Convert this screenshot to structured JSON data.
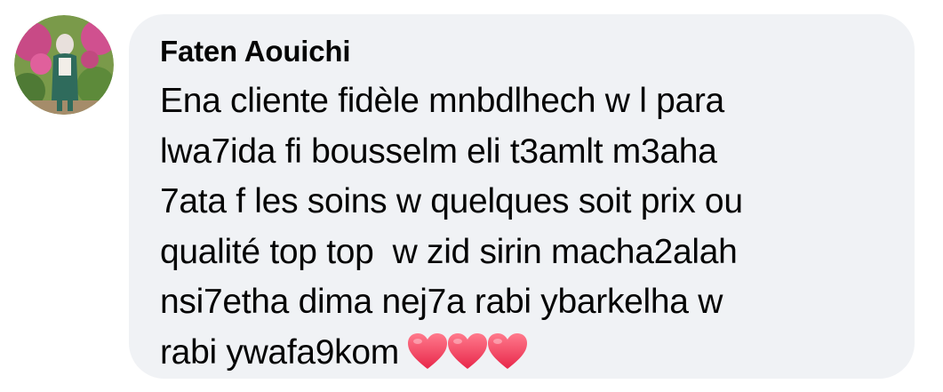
{
  "comment": {
    "author": "Faten Aouichi",
    "lines": [
      "Ena cliente fidèle mnbdlhech w l para",
      "lwa7ida fi bousselm eli t3amlt m3aha",
      "7ata f les soins w quelques soit prix ou",
      "qualité top top  w zid sirin macha2alah",
      "nsi7etha dima nej7a rabi ybarkelha w",
      "rabi ywafa9kom"
    ],
    "emojis": [
      "heart-emoji",
      "heart-emoji",
      "heart-emoji"
    ]
  },
  "colors": {
    "bubble_bg": "#f0f2f5",
    "text": "#050505",
    "heart": "#f0475f"
  }
}
